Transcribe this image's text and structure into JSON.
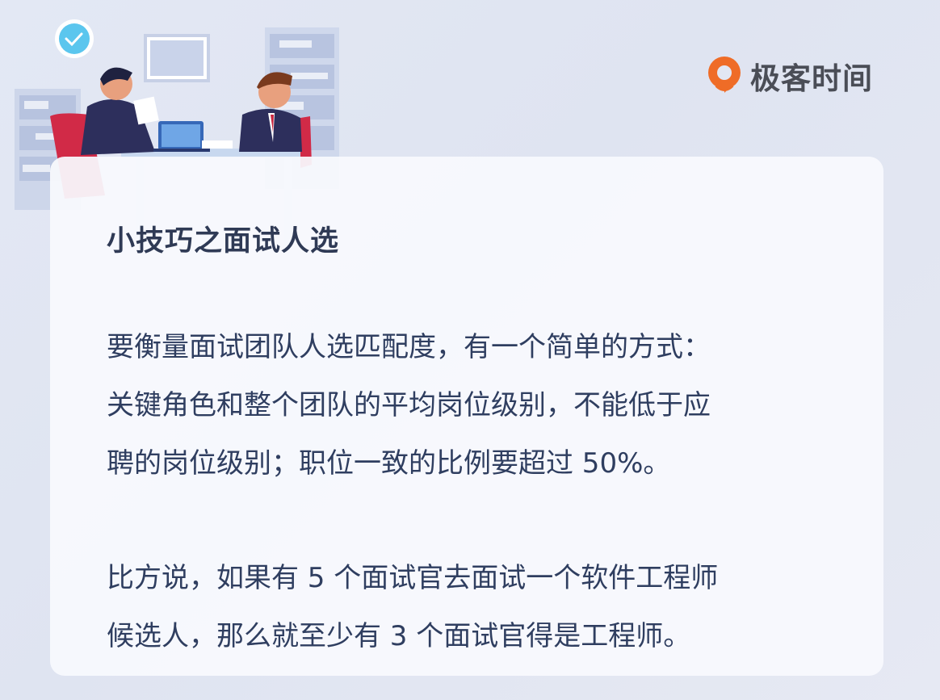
{
  "brand": {
    "name": "极客时间"
  },
  "colors": {
    "background": "#e2e7f3",
    "card": "#f8f9fd",
    "title": "#2f3a55",
    "body_text": "#2f3e60",
    "logo_accent": "#ef6c27"
  },
  "illustration": {
    "icon": "office-interview-illustration"
  },
  "card": {
    "title": "小技巧之面试人选",
    "paragraphs": [
      {
        "lines": [
          "要衡量面试团队人选匹配度，有一个简单的方式：",
          "关键角色和整个团队的平均岗位级别，不能低于应",
          "聘的岗位级别；职位一致的比例要超过 50%。"
        ]
      },
      {
        "lines": [
          "比方说，如果有 5 个面试官去面试一个软件工程师",
          "候选人，那么就至少有 3 个面试官得是工程师。"
        ]
      }
    ]
  }
}
